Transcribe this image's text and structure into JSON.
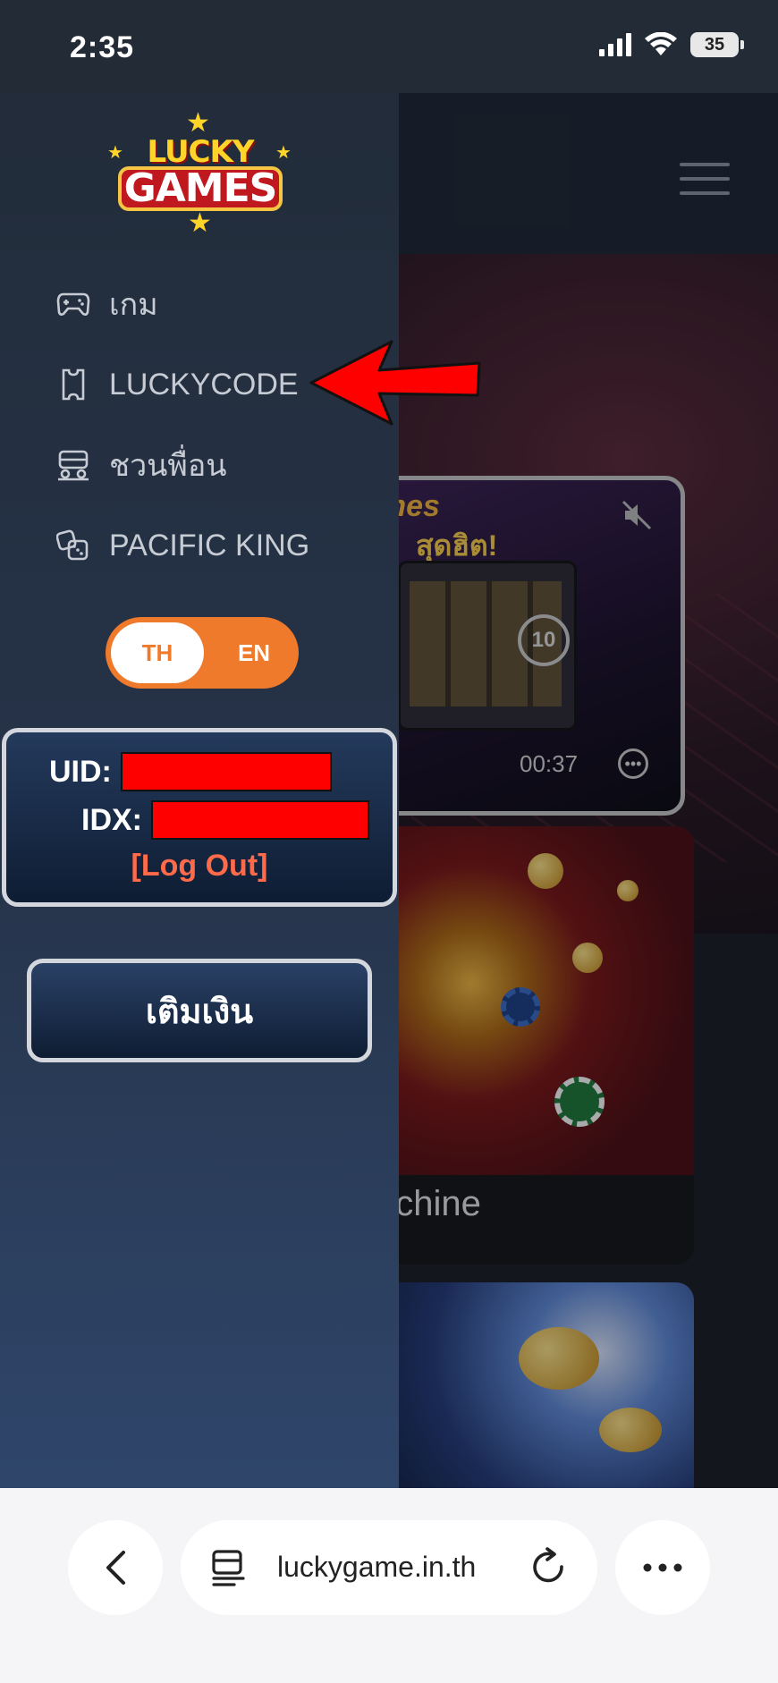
{
  "status_bar": {
    "time": "2:35",
    "battery": "35"
  },
  "drawer": {
    "logo": {
      "top": "LUCKY",
      "bottom": "GAMES"
    },
    "nav": [
      {
        "label": "เกม",
        "icon": "gamepad-icon"
      },
      {
        "label": "LUCKYCODE",
        "icon": "ticket-icon"
      },
      {
        "label": "ชวนพื่อน",
        "icon": "invite-friends-icon"
      },
      {
        "label": "PACIFIC KING",
        "icon": "dice-icon"
      }
    ],
    "lang": {
      "th": "TH",
      "en": "EN",
      "selected": "TH"
    },
    "account": {
      "uid_label": "UID:",
      "idx_label": "IDX:",
      "logout": "[Log Out]"
    },
    "topup_button": "เติมเงิน"
  },
  "background": {
    "video": {
      "title": "ames",
      "subtitle": "สุดฮิต!",
      "replay": "10",
      "time": "00:37"
    },
    "game_card_label": "achine"
  },
  "browser": {
    "url": "luckygame.in.th"
  },
  "colors": {
    "accent_orange": "#f07a2c",
    "logout_red": "#ff6a4a",
    "redaction": "#ff0000",
    "annotation_arrow": "#ff0000"
  }
}
